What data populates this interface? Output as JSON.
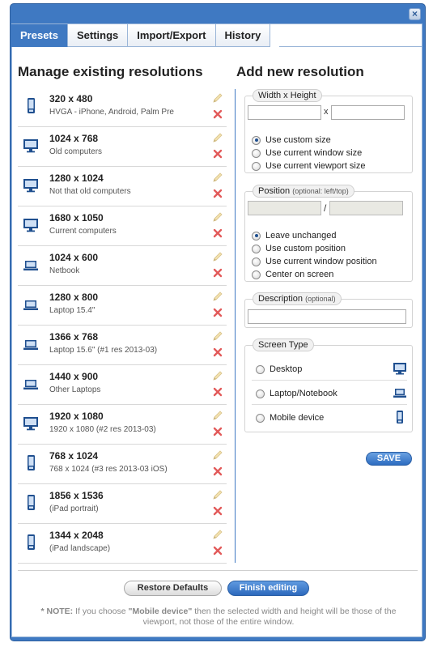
{
  "colors": {
    "accent": "#3f79c2",
    "delete": "#e04a4a",
    "edit": "#e0c070"
  },
  "window": {
    "close_label": "×"
  },
  "tabs": [
    {
      "label": "Presets",
      "active": true
    },
    {
      "label": "Settings",
      "active": false
    },
    {
      "label": "Import/Export",
      "active": false
    },
    {
      "label": "History",
      "active": false
    }
  ],
  "manage": {
    "title": "Manage existing resolutions",
    "items": [
      {
        "res": "320 x 480",
        "desc": "HVGA - iPhone, Android, Palm Pre",
        "icon": "mobile-icon"
      },
      {
        "res": "1024 x 768",
        "desc": "Old computers",
        "icon": "desktop-icon"
      },
      {
        "res": "1280 x 1024",
        "desc": "Not that old computers",
        "icon": "desktop-icon"
      },
      {
        "res": "1680 x 1050",
        "desc": "Current computers",
        "icon": "desktop-icon"
      },
      {
        "res": "1024 x 600",
        "desc": "Netbook",
        "icon": "laptop-icon"
      },
      {
        "res": "1280 x 800",
        "desc": "Laptop 15.4\"",
        "icon": "laptop-icon"
      },
      {
        "res": "1366 x 768",
        "desc": "Laptop 15.6\" (#1 res 2013-03)",
        "icon": "laptop-icon"
      },
      {
        "res": "1440 x 900",
        "desc": "Other Laptops",
        "icon": "laptop-icon"
      },
      {
        "res": "1920 x 1080",
        "desc": "1920 x 1080 (#2 res 2013-03)",
        "icon": "desktop-icon"
      },
      {
        "res": "768 x 1024",
        "desc": "768 x 1024 (#3 res 2013-03 iOS)",
        "icon": "mobile-icon"
      },
      {
        "res": "1856 x 1536",
        "desc": "(iPad portrait)",
        "icon": "mobile-icon"
      },
      {
        "res": "1344 x 2048",
        "desc": "(iPad landscape)",
        "icon": "mobile-icon"
      }
    ]
  },
  "add": {
    "title": "Add new resolution",
    "size": {
      "legend": "Width x Height",
      "separator": "x",
      "width_value": "",
      "height_value": "",
      "options": [
        "Use custom size",
        "Use current window size",
        "Use current viewport size"
      ],
      "selected": 0
    },
    "position": {
      "legend": "Position",
      "legend_hint": "(optional: left/top)",
      "separator": "/",
      "left_value": "",
      "top_value": "",
      "options": [
        "Leave unchanged",
        "Use custom position",
        "Use current window position",
        "Center on screen"
      ],
      "selected": 0
    },
    "description": {
      "legend": "Description",
      "legend_hint": "(optional)",
      "value": ""
    },
    "screen_type": {
      "legend": "Screen Type",
      "options": [
        {
          "label": "Desktop",
          "icon": "desktop-icon"
        },
        {
          "label": "Laptop/Notebook",
          "icon": "laptop-icon"
        },
        {
          "label": "Mobile device",
          "icon": "mobile-icon"
        }
      ]
    },
    "save_label": "SAVE"
  },
  "footer": {
    "restore_label": "Restore Defaults",
    "finish_label": "Finish editing",
    "note_prefix": "* NOTE:",
    "note_mid1": " If you choose ",
    "note_em": "\"Mobile device\"",
    "note_rest": " then the selected width and height will be those of the viewport, not those of the entire window."
  }
}
